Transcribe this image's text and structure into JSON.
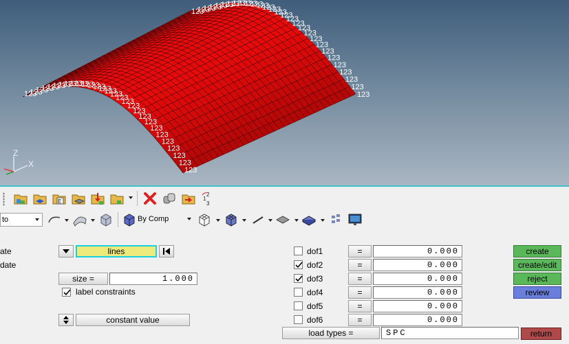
{
  "viewport": {
    "constraint_label": "123",
    "triad": {
      "z": "Z",
      "x": "X"
    },
    "mesh_color": "#cc0a0a",
    "background_top": "#3f5d7c",
    "background_bottom": "#aab6c2"
  },
  "toolbar1": {
    "icons": [
      "components-icon",
      "assemblies-icon",
      "materials-icon",
      "properties-icon",
      "load-collectors-icon",
      "sets-icon",
      "delete-icon",
      "organize-icon",
      "move-icon",
      "renumber-icon"
    ]
  },
  "toolbar2": {
    "combo_left": "to",
    "color_mode": "By Comp",
    "icons": [
      "curve-icon",
      "surface-icon",
      "solid-icon",
      "component-color-icon",
      "wireframe-icon",
      "shaded-elements-icon",
      "line-style-icon",
      "plane-icon",
      "surface-shading-icon",
      "visualization-options-icon",
      "display-icon"
    ]
  },
  "panel": {
    "subpanels": [
      "ate",
      "date"
    ],
    "entity_type": "lines",
    "size_label": "size =",
    "size_value": "1.000",
    "label_constraints": "label constraints",
    "label_constraints_checked": true,
    "value_mode": "constant value",
    "dofs": [
      {
        "label": "dof1",
        "checked": false,
        "eq": "=",
        "value": "0.000"
      },
      {
        "label": "dof2",
        "checked": true,
        "eq": "=",
        "value": "0.000"
      },
      {
        "label": "dof3",
        "checked": true,
        "eq": "=",
        "value": "0.000"
      },
      {
        "label": "dof4",
        "checked": false,
        "eq": "=",
        "value": "0.000"
      },
      {
        "label": "dof5",
        "checked": false,
        "eq": "=",
        "value": "0.000"
      },
      {
        "label": "dof6",
        "checked": false,
        "eq": "=",
        "value": "0.000"
      }
    ],
    "load_types_label": "load types =",
    "load_type_value": "SPC",
    "actions": {
      "create": "create",
      "create_edit": "create/edit",
      "reject": "reject",
      "review": "review",
      "return": "return"
    },
    "colors": {
      "entity_selector": "#ecea7a",
      "entity_selector_border": "#18d0e0",
      "action_green": "#5ab85a",
      "review_blue": "#6a7fdc",
      "return_red": "#b04a4a"
    }
  }
}
